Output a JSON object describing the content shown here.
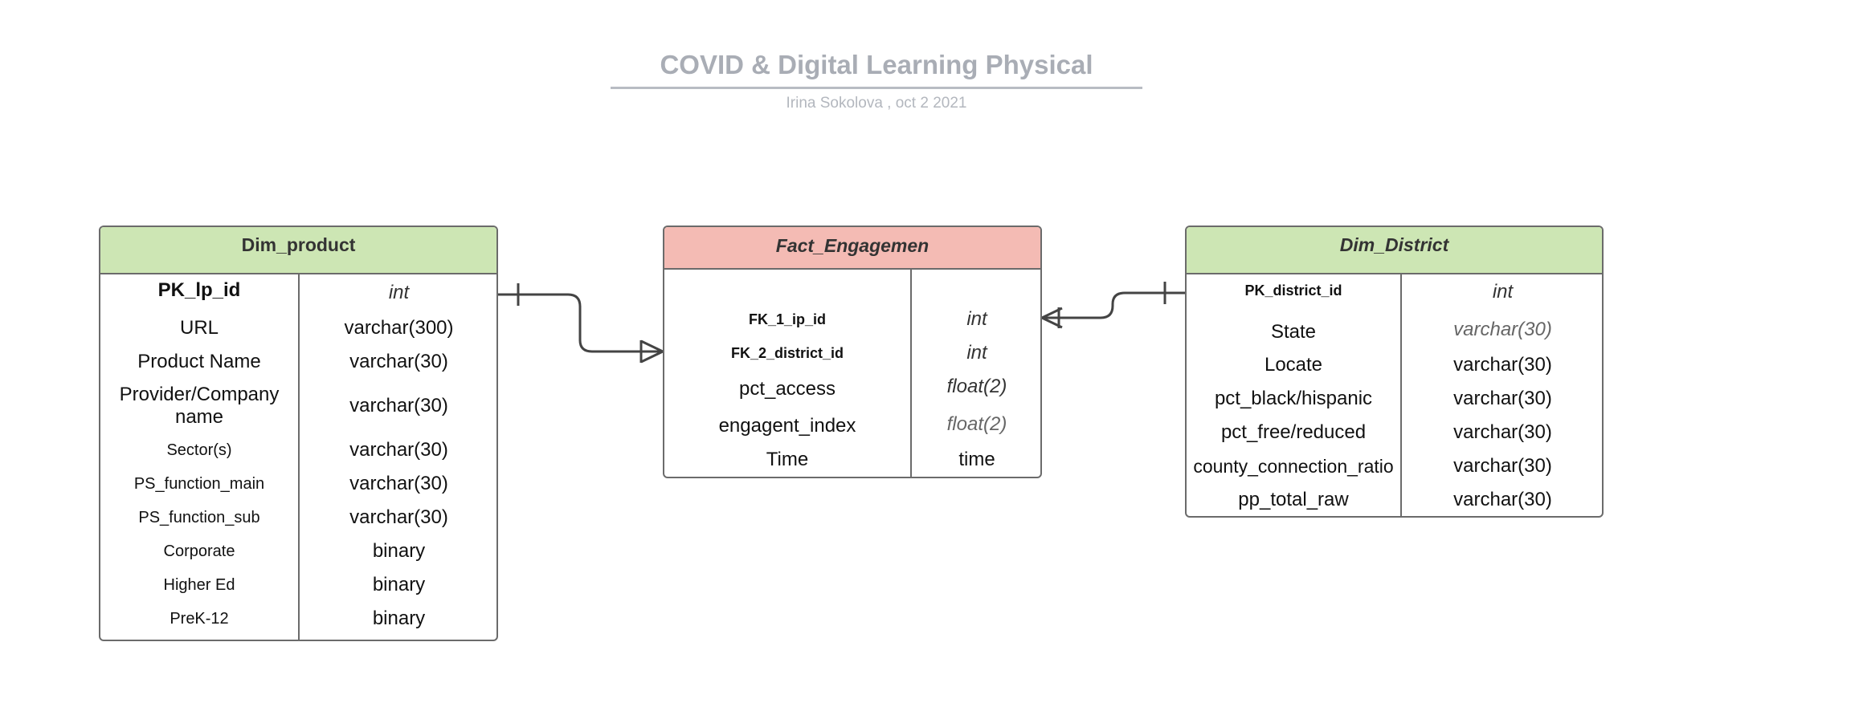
{
  "diagram": {
    "title": "COVID & Digital Learning Physical",
    "subtitle": "Irina Sokolova , oct 2 2021"
  },
  "dim_product": {
    "name": "Dim_product",
    "rows": [
      {
        "field": "PK_lp_id",
        "type": "int"
      },
      {
        "field": "URL",
        "type": "varchar(300)"
      },
      {
        "field": "Product Name",
        "type": "varchar(30)"
      },
      {
        "field": "Provider/Company name",
        "type": "varchar(30)"
      },
      {
        "field": "Sector(s)",
        "type": "varchar(30)"
      },
      {
        "field": "PS_function_main",
        "type": "varchar(30)"
      },
      {
        "field": "PS_function_sub",
        "type": "varchar(30)"
      },
      {
        "field": "Corporate",
        "type": "binary"
      },
      {
        "field": "Higher Ed",
        "type": "binary"
      },
      {
        "field": "PreK-12",
        "type": "binary"
      }
    ]
  },
  "fact_engagement": {
    "name": "Fact_Engagemen",
    "rows": [
      {
        "field": "FK_1_ip_id",
        "type": "int"
      },
      {
        "field": "FK_2_district_id",
        "type": "int"
      },
      {
        "field": "pct_access",
        "type": "float(2)"
      },
      {
        "field": "engagent_index",
        "type": "float(2)"
      },
      {
        "field": "Time",
        "type": "time"
      }
    ]
  },
  "dim_district": {
    "name": "Dim_District",
    "rows": [
      {
        "field": "PK_district_id",
        "type": "int"
      },
      {
        "field": "State",
        "type": "varchar(30)"
      },
      {
        "field": "Locate",
        "type": "varchar(30)"
      },
      {
        "field": "pct_black/hispanic",
        "type": "varchar(30)"
      },
      {
        "field": "pct_free/reduced",
        "type": "varchar(30)"
      },
      {
        "field": "county_connection_ratio",
        "type": "varchar(30)"
      },
      {
        "field": "pp_total_raw",
        "type": "varchar(30)"
      }
    ]
  },
  "colors": {
    "dimension_header": "#cde6b4",
    "fact_header": "#f4bbb4",
    "border": "#6b6b6b",
    "title": "#a9adb5"
  }
}
